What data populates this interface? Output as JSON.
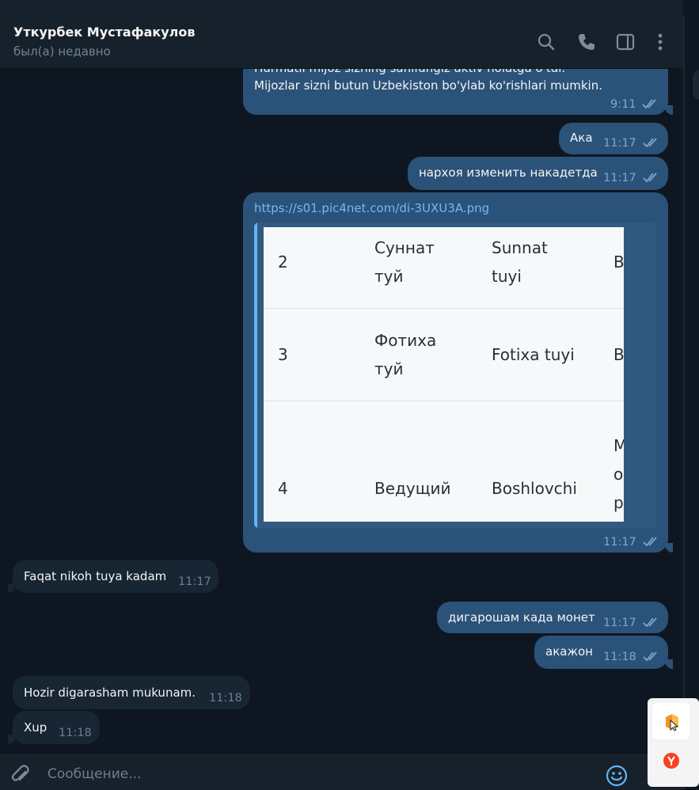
{
  "header": {
    "contact_name": "Уткурбек Мустафакулов",
    "status": "был(а) недавно",
    "icons": [
      "search-icon",
      "phone-icon",
      "sidebar-toggle-icon",
      "more-vertical-icon"
    ]
  },
  "messages": [
    {
      "id": "m1",
      "direction": "out",
      "lines": [
        "Hurmatli mijoz sizning sahifangiz aktiv holatga o'tdi.",
        "Mijozlar sizni butun Uzbekiston bo'ylab ko'rishlari mumkin."
      ],
      "time": "9:11",
      "read": true
    },
    {
      "id": "m2",
      "direction": "out",
      "text": "Ака",
      "time": "11:17",
      "read": true
    },
    {
      "id": "m3",
      "direction": "out",
      "text": "нархоя изменить накадетда",
      "time": "11:17",
      "read": true
    },
    {
      "id": "m4",
      "direction": "out",
      "link": "https://s01.pic4net.com/di-3UXU3A.png",
      "time": "11:17",
      "read": true,
      "preview_table": [
        {
          "num": "2",
          "ru": [
            "Суннат",
            "туй"
          ],
          "uz": [
            "Sunnat",
            "tuyi"
          ],
          "extra": [
            "B"
          ]
        },
        {
          "num": "3",
          "ru": [
            "Фотиха",
            "туй"
          ],
          "uz": [
            "Fotixa tuyi"
          ],
          "extra": [
            "B"
          ]
        },
        {
          "num": "4",
          "ru": [
            "Ведущий"
          ],
          "uz": [
            "Boshlovchi"
          ],
          "extra": [
            "M",
            "o",
            "p"
          ]
        }
      ]
    },
    {
      "id": "m5",
      "direction": "in",
      "text": "Faqat nikoh tuya kadam",
      "time": "11:17"
    },
    {
      "id": "m6",
      "direction": "out",
      "text": "дигарошам када монет",
      "time": "11:17",
      "read": true
    },
    {
      "id": "m7",
      "direction": "out",
      "text": "акажон",
      "time": "11:18",
      "read": true
    },
    {
      "id": "m8",
      "direction": "in",
      "text": "Hozir digarasham mukunam.",
      "time": "11:18"
    },
    {
      "id": "m9",
      "direction": "in",
      "text": "Xup",
      "time": "11:18"
    }
  ],
  "composer": {
    "placeholder": "Сообщение...",
    "icons": [
      "attach-icon",
      "emoji-icon"
    ]
  },
  "popup": {
    "icons": [
      "orange-app-icon",
      "yandex-icon"
    ]
  },
  "colors": {
    "background": "#0e1621",
    "header": "#17212b",
    "outgoing_bubble": "#2b5278",
    "incoming_bubble": "#182533",
    "accent": "#64b5f6"
  }
}
